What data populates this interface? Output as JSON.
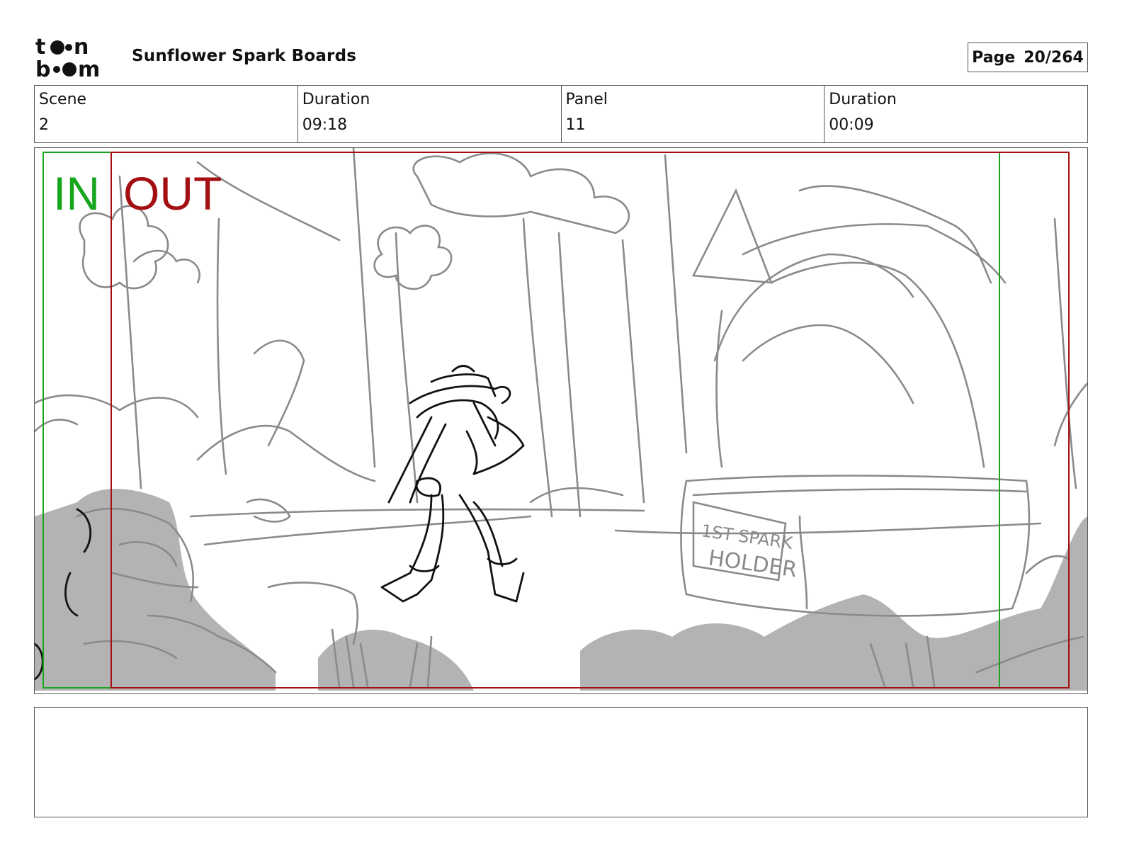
{
  "header": {
    "logo": {
      "icon": "toonboom-logo",
      "lines": [
        "t••n",
        "b••m"
      ]
    },
    "project_title": "Sunflower Spark Boards",
    "page_label": "Page",
    "page_value": "20/264"
  },
  "info": {
    "scene_label": "Scene",
    "scene_value": "2",
    "scene_duration_label": "Duration",
    "scene_duration_value": "09:18",
    "panel_label": "Panel",
    "panel_value": "11",
    "panel_duration_label": "Duration",
    "panel_duration_value": "00:09"
  },
  "panel": {
    "marker_in": "IN",
    "marker_out": "OUT",
    "sign_text": [
      "1ST SPARK",
      "HOLDER"
    ],
    "colors": {
      "in": "#16a51d",
      "out": "#a30f12",
      "sketch": "#8a8a8a",
      "shadow": "#b3b3b3",
      "ink": "#111111"
    }
  },
  "notes": {
    "text": ""
  }
}
